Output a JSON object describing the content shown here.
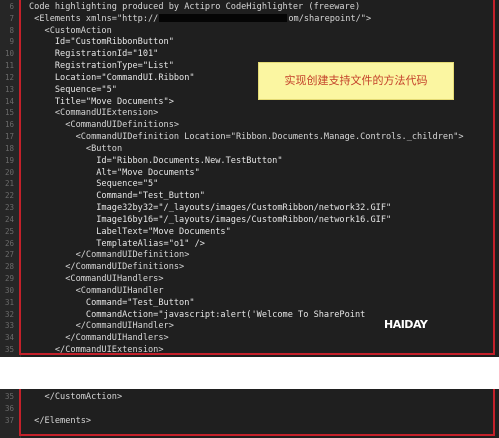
{
  "top_lines": [
    {
      "num": "6",
      "text": "Code highlighting produced by Actipro CodeHighlighter (freeware)",
      "kind": "comment"
    },
    {
      "num": "7",
      "text": " <Elements xmlns=\"http://",
      "tail": "om/sharepoint/\">",
      "kind": "tag",
      "redacted": true
    },
    {
      "num": "8",
      "text": "   <CustomAction",
      "kind": "tag"
    },
    {
      "num": "9",
      "text": "     Id=\"CustomRibbonButton\"",
      "kind": "attr"
    },
    {
      "num": "10",
      "text": "     RegistrationId=\"101\"",
      "kind": "attr"
    },
    {
      "num": "11",
      "text": "     RegistrationType=\"List\"",
      "kind": "attr"
    },
    {
      "num": "12",
      "text": "     Location=\"CommandUI.Ribbon\"",
      "kind": "attr"
    },
    {
      "num": "13",
      "text": "     Sequence=\"5\"",
      "kind": "attr"
    },
    {
      "num": "14",
      "text": "     Title=\"Move Documents\">",
      "kind": "attr"
    },
    {
      "num": "15",
      "text": "     <CommandUIExtension>",
      "kind": "tag"
    },
    {
      "num": "16",
      "text": "       <CommandUIDefinitions>",
      "kind": "tag"
    },
    {
      "num": "17",
      "text": "         <CommandUIDefinition Location=\"Ribbon.Documents.Manage.Controls._children\">",
      "kind": "tag"
    },
    {
      "num": "18",
      "text": "           <Button",
      "kind": "tag"
    },
    {
      "num": "19",
      "text": "             Id=\"Ribbon.Documents.New.TestButton\"",
      "kind": "attr"
    },
    {
      "num": "20",
      "text": "             Alt=\"Move Documents\"",
      "kind": "attr"
    },
    {
      "num": "21",
      "text": "             Sequence=\"5\"",
      "kind": "attr"
    },
    {
      "num": "22",
      "text": "             Command=\"Test_Button\"",
      "kind": "attr"
    },
    {
      "num": "23",
      "text": "             Image32by32=\"/_layouts/images/CustomRibbon/network32.GIF\"",
      "kind": "attr"
    },
    {
      "num": "24",
      "text": "             Image16by16=\"/_layouts/images/CustomRibbon/network16.GIF\"",
      "kind": "attr"
    },
    {
      "num": "25",
      "text": "             LabelText=\"Move Documents\"",
      "kind": "attr"
    },
    {
      "num": "26",
      "text": "             TemplateAlias=\"o1\" />",
      "kind": "attr"
    },
    {
      "num": "27",
      "text": "         </CommandUIDefinition>",
      "kind": "tag"
    },
    {
      "num": "28",
      "text": "       </CommandUIDefinitions>",
      "kind": "tag"
    },
    {
      "num": "29",
      "text": "       <CommandUIHandlers>",
      "kind": "tag"
    },
    {
      "num": "30",
      "text": "         <CommandUIHandler",
      "kind": "tag"
    },
    {
      "num": "31",
      "text": "           Command=\"Test_Button\"",
      "kind": "attr"
    },
    {
      "num": "32",
      "text": "           CommandAction=\"javascript:alert('Welcome To SharePoint",
      "kind": "attr"
    },
    {
      "num": "33",
      "text": "         </CommandUIHandler>",
      "kind": "tag"
    },
    {
      "num": "34",
      "text": "       </CommandUIHandlers>",
      "kind": "tag"
    },
    {
      "num": "35",
      "text": "     </CommandUIExtension>",
      "kind": "tag"
    }
  ],
  "bottom_lines": [
    {
      "num": "35",
      "text": "   </CustomAction>",
      "kind": "tag"
    },
    {
      "num": "36",
      "text": "",
      "kind": "tag"
    },
    {
      "num": "37",
      "text": " </Elements>",
      "kind": "tag"
    }
  ],
  "annotation_note": "实现创建支持文件的方法代码",
  "watermark_text": "HAIDAY",
  "colors": {
    "editor_bg": "#1f1f1f",
    "frame_red": "#c4202a",
    "note_bg": "#fbf6a1",
    "note_text": "#c4412a"
  }
}
